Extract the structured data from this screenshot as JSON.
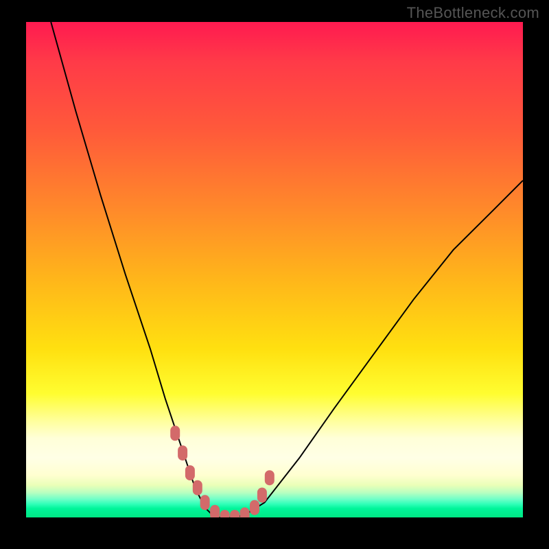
{
  "watermark": "TheBottleneck.com",
  "chart_data": {
    "type": "line",
    "title": "",
    "xlabel": "",
    "ylabel": "",
    "xlim": [
      0,
      100
    ],
    "ylim": [
      0,
      100
    ],
    "grid": false,
    "legend": false,
    "series": [
      {
        "name": "bottleneck-curve",
        "x": [
          5,
          10,
          15,
          20,
          25,
          28,
          30,
          32,
          34,
          36,
          38,
          40,
          42,
          44,
          48,
          55,
          62,
          70,
          78,
          86,
          94,
          100
        ],
        "y": [
          100,
          82,
          65,
          49,
          34,
          24,
          18,
          12,
          6,
          2,
          0,
          0,
          0,
          0.5,
          3,
          12,
          22,
          33,
          44,
          54,
          62,
          68
        ]
      },
      {
        "name": "highlight-markers",
        "x": [
          30,
          31.5,
          33,
          34.5,
          36,
          38,
          40,
          42,
          44,
          46,
          47.5,
          49
        ],
        "y": [
          17,
          13,
          9,
          6,
          3,
          1,
          0,
          0,
          0.5,
          2,
          4.5,
          8
        ]
      }
    ],
    "colors": {
      "curve": "#000000",
      "marker": "#d36a6a"
    }
  }
}
